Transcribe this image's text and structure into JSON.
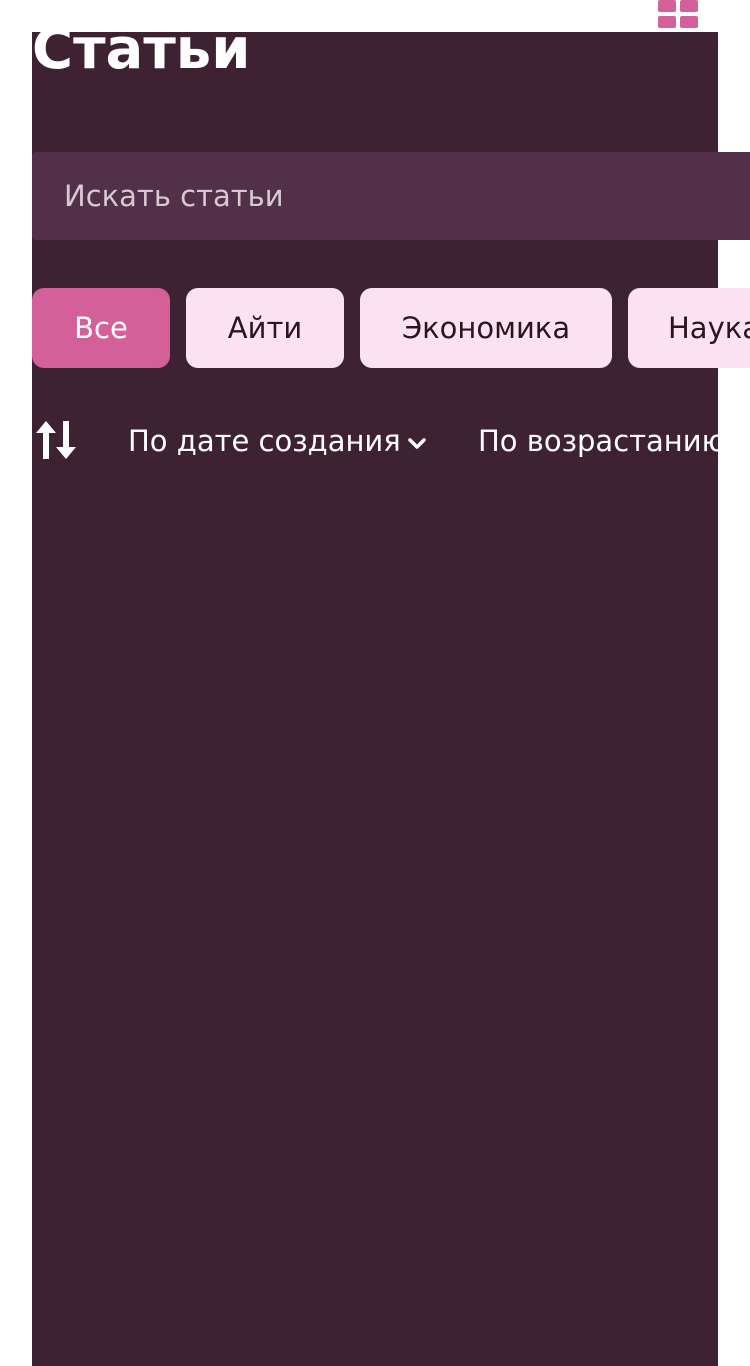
{
  "header": {
    "title": "Статьи",
    "view_toggle_icon": "grid-view-icon"
  },
  "search": {
    "placeholder": "Искать статьи",
    "value": ""
  },
  "categories": [
    {
      "label": "Все",
      "active": true
    },
    {
      "label": "Айти",
      "active": false
    },
    {
      "label": "Экономика",
      "active": false
    },
    {
      "label": "Наука",
      "active": false
    }
  ],
  "sort": {
    "direction_icon": "sort-direction-icon",
    "field_label": "По дате создания",
    "field_icon": "chevron-down-icon",
    "order_label": "По возрастанию"
  },
  "colors": {
    "background": "#3f2232",
    "search_bg": "#52304a",
    "accent": "#d4609a",
    "chip_bg": "#fde3f1"
  }
}
